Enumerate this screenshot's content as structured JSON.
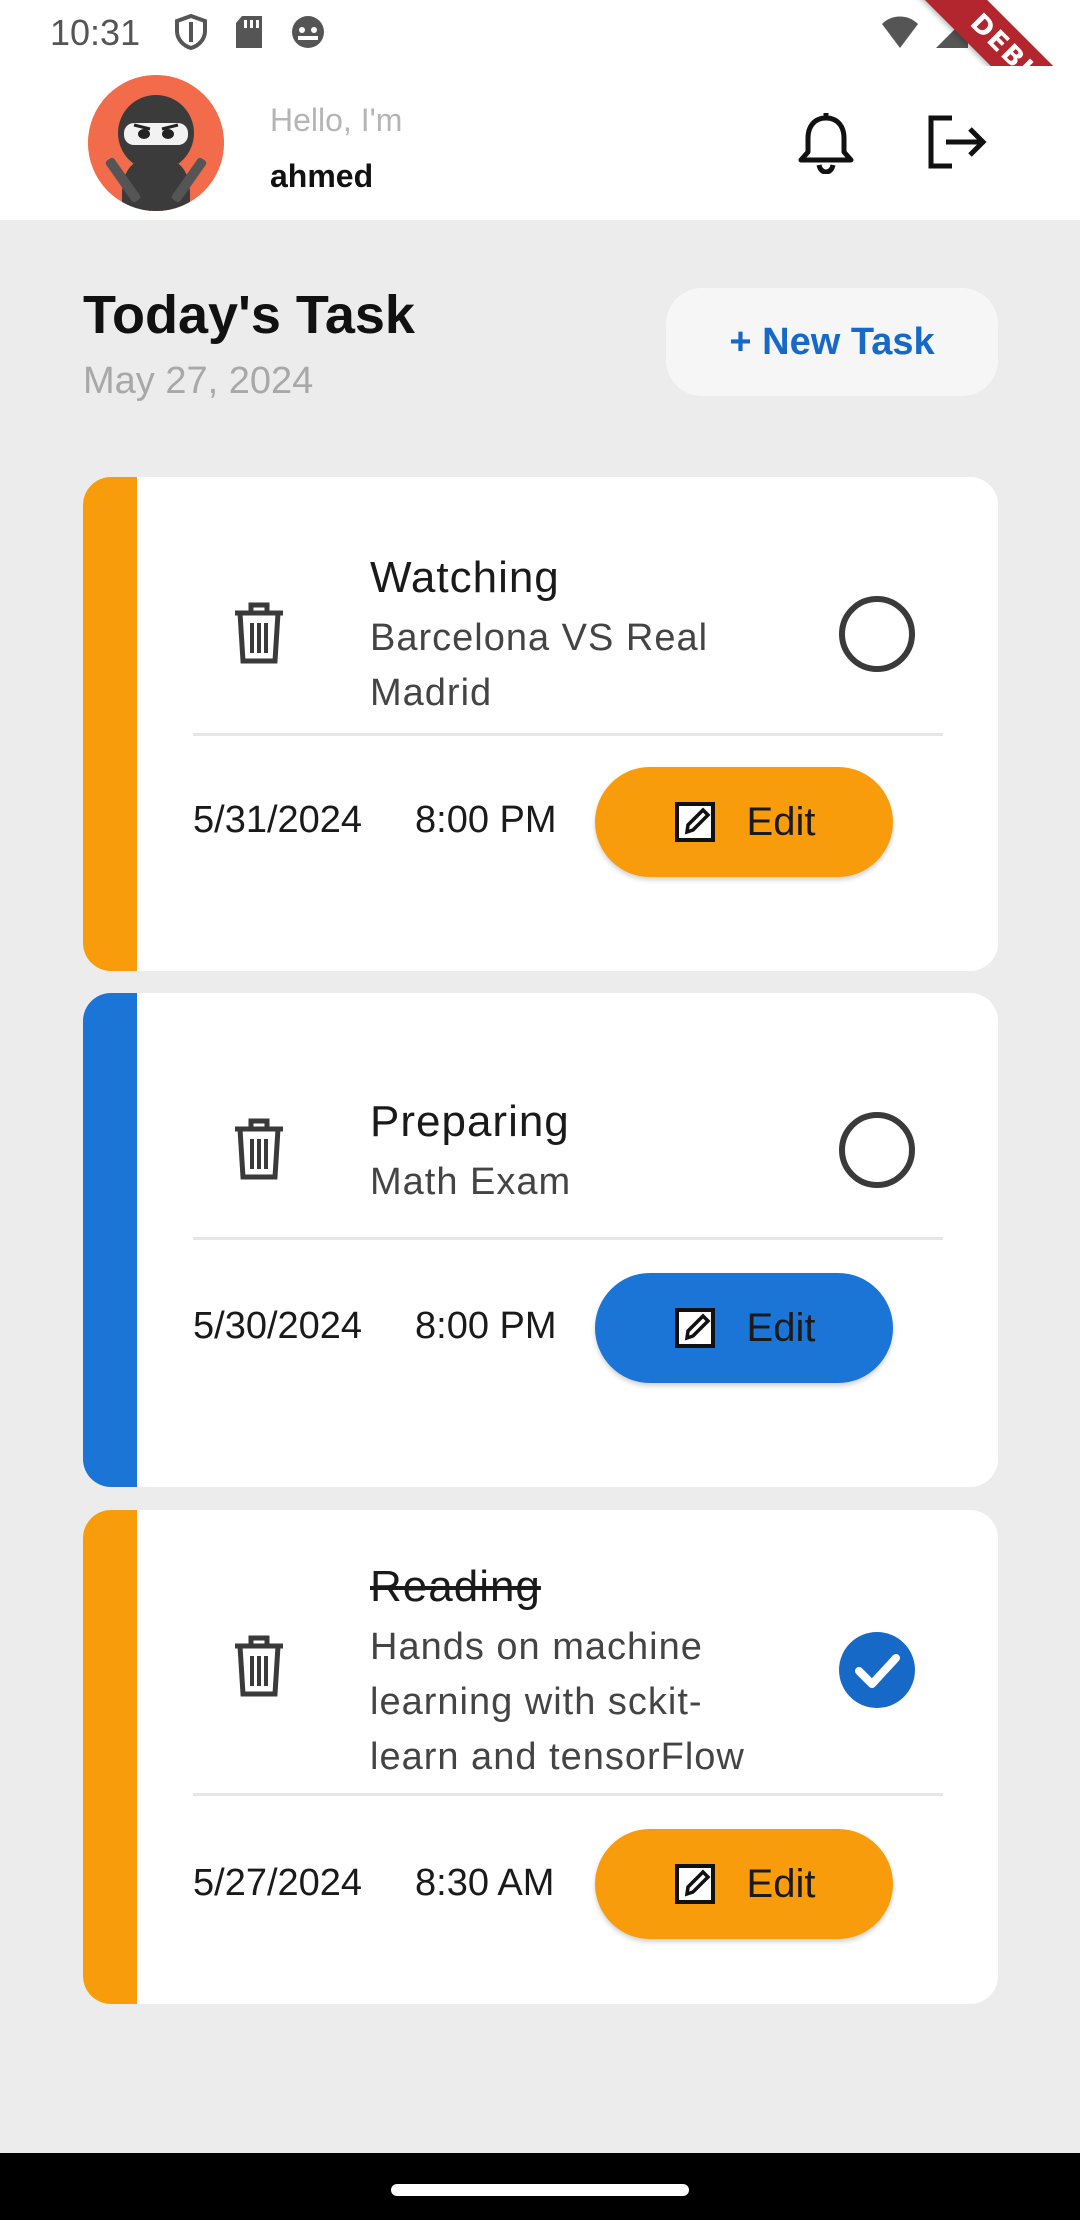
{
  "status_bar": {
    "time": "10:31",
    "debug_banner": "DEBUG"
  },
  "header": {
    "greeting": "Hello, I'm",
    "user_name": "ahmed"
  },
  "page": {
    "title": "Today's Task",
    "date": "May 27, 2024",
    "new_task_label": "+ New Task"
  },
  "tasks": [
    {
      "title": "Watching",
      "description": "Barcelona VS Real Madrid",
      "date": "5/31/2024",
      "time": "8:00 PM",
      "edit_label": "Edit",
      "completed": false,
      "color": "#f99c0b"
    },
    {
      "title": "Preparing",
      "description": "Math Exam",
      "date": "5/30/2024",
      "time": "8:00 PM",
      "edit_label": "Edit",
      "completed": false,
      "color": "#1b75d6"
    },
    {
      "title": "Reading",
      "description": "Hands on machine learning with sckit-learn and tensorFlow",
      "date": "5/27/2024",
      "time": "8:30 AM",
      "edit_label": "Edit",
      "completed": true,
      "color": "#f99c0b"
    }
  ],
  "colors": {
    "accent_blue": "#1769c7",
    "orange": "#f99c0b",
    "blue": "#1b75d6",
    "background": "#ececec"
  },
  "icons": [
    "shield-icon",
    "sd-card-icon",
    "android-icon",
    "wifi-icon",
    "signal-icon",
    "battery-icon",
    "bell-icon",
    "logout-icon",
    "trash-icon",
    "edit-icon",
    "check-icon"
  ]
}
